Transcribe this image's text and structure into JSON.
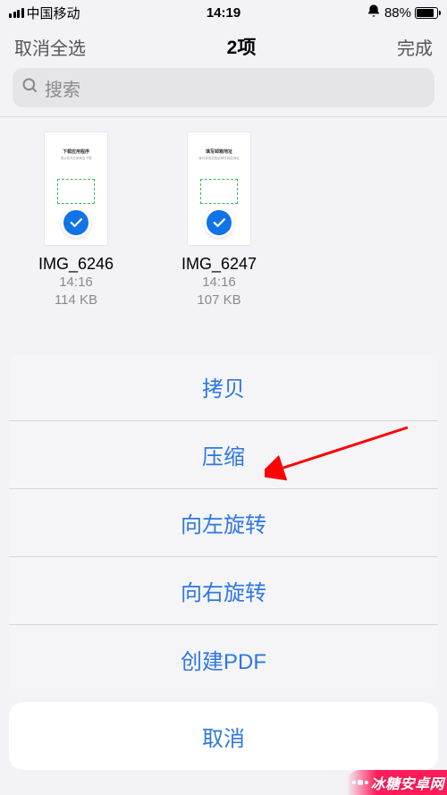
{
  "status": {
    "carrier": "中国移动",
    "time": "14:19",
    "battery_pct": "88%",
    "battery_fill": 88
  },
  "nav": {
    "left": "取消全选",
    "title": "2项",
    "right": "完成"
  },
  "search": {
    "placeholder": "搜索"
  },
  "files": [
    {
      "name": "IMG_6246",
      "time": "14:16",
      "size": "114 KB"
    },
    {
      "name": "IMG_6247",
      "time": "14:16",
      "size": "107 KB"
    }
  ],
  "sheet": {
    "items": [
      "拷贝",
      "压缩",
      "向左旋转",
      "向右旋转",
      "创建PDF"
    ],
    "cancel": "取消"
  },
  "watermark": "冰糖安卓网",
  "colors": {
    "accent_blue": "#2f77e0",
    "select_blue": "#1073e6",
    "annotation_red": "#ff0000",
    "watermark_pink": "#ff1a5a"
  }
}
